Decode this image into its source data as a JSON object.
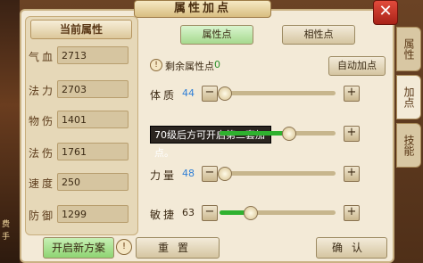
{
  "dialog": {
    "title": "属性加点",
    "close_icon": "close-icon"
  },
  "left_strip": {
    "chars": [
      "费",
      "手"
    ]
  },
  "current_stats": {
    "header": "当前属性",
    "rows": [
      {
        "label": "气血",
        "value": "2713"
      },
      {
        "label": "法力",
        "value": "2703"
      },
      {
        "label": "物伤",
        "value": "1401"
      },
      {
        "label": "法伤",
        "value": "1761"
      },
      {
        "label": "速度",
        "value": "250"
      },
      {
        "label": "防御",
        "value": "1299"
      }
    ],
    "new_plan_label": "开启新方案",
    "warn_icon": "!"
  },
  "tabs": {
    "attribute_points": "属性点",
    "phase_points": "相性点"
  },
  "side_tabs": [
    "属性",
    "加点",
    "技能"
  ],
  "remaining": {
    "icon": "!",
    "label": "剩余属性点",
    "value": "0"
  },
  "auto_button": "自动加点",
  "attributes": [
    {
      "label": "体质",
      "value": "44",
      "value_color": "#2f7fd6",
      "fill": 0.0
    },
    {
      "label": "灵力",
      "value": "",
      "value_color": "#2f7fd6",
      "fill": 0.55
    },
    {
      "label": "力量",
      "value": "48",
      "value_color": "#2f7fd6",
      "fill": 0.0
    },
    {
      "label": "敏捷",
      "value": "63",
      "value_color": "#3c2a14",
      "fill": 0.22
    }
  ],
  "tooltip": "70级后方可开启第二套加点。",
  "footer": {
    "reset_label": "重置",
    "confirm_label": "确认"
  },
  "colors": {
    "accent_green": "#2fb12f",
    "close_red": "#c0392b"
  }
}
